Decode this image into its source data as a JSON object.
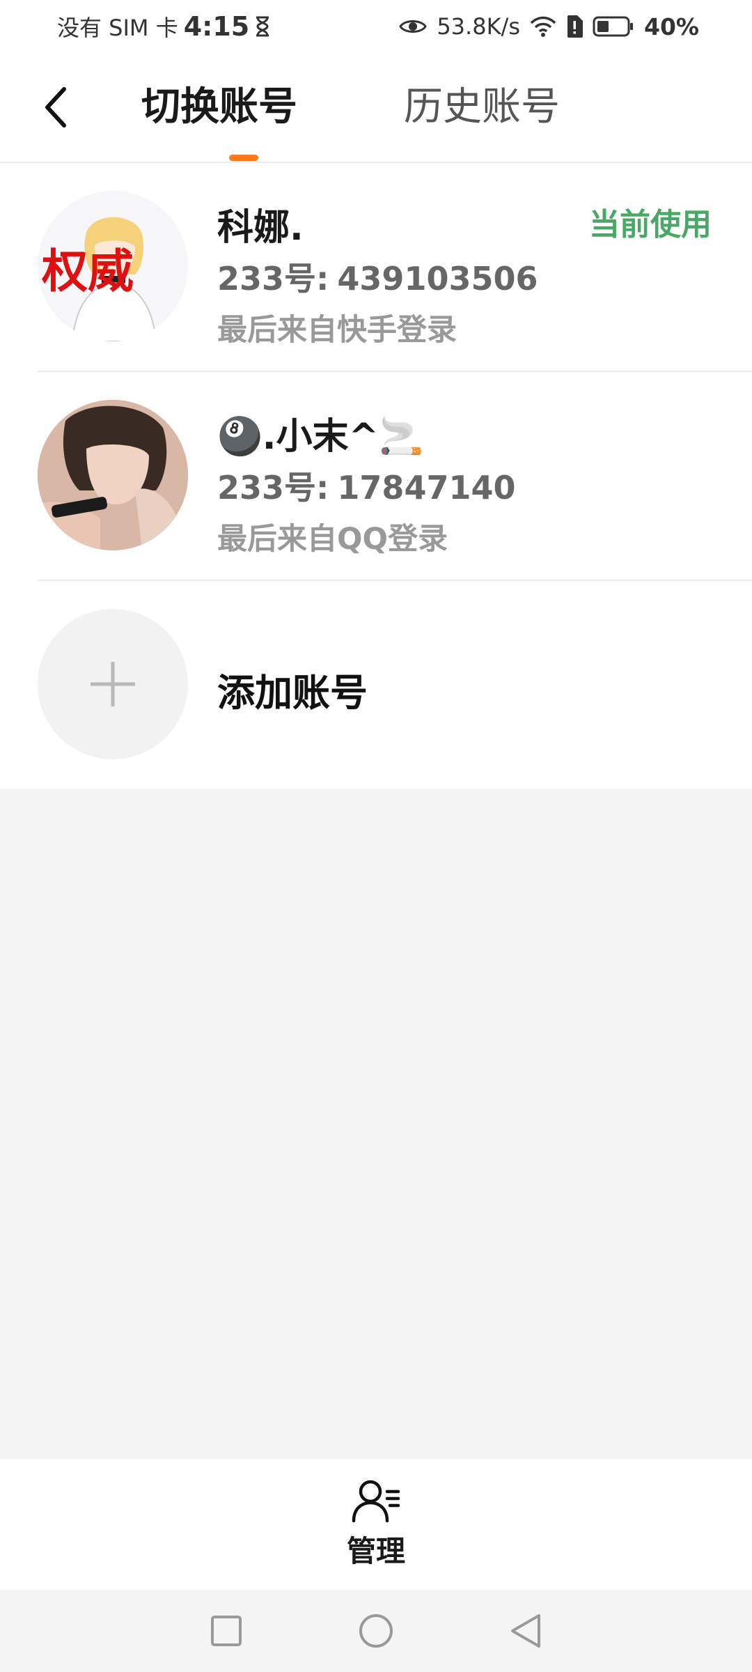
{
  "status_bar": {
    "carrier": "没有 SIM 卡",
    "time": "4:15",
    "net_speed": "53.8K/s",
    "battery_percent": "40%",
    "battery_level": 0.4
  },
  "header": {
    "tabs": [
      {
        "label": "切换账号",
        "active": true
      },
      {
        "label": "历史账号",
        "active": false
      }
    ],
    "accent_color": "#ff7a1a"
  },
  "accounts": [
    {
      "name": "科娜.",
      "uid_label": "233号:",
      "uid": "439103506",
      "login_source": "最后来自快手登录",
      "badge": "当前使用",
      "avatar_text": "权威"
    },
    {
      "name": "🎱.小末^🚬",
      "uid_label": "233号:",
      "uid": "17847140",
      "login_source": "最后来自QQ登录"
    }
  ],
  "add_account": {
    "label": "添加账号"
  },
  "bottom_bar": {
    "manage_label": "管理"
  },
  "colors": {
    "current_badge": "#4aa866",
    "background": "#f4f4f4"
  }
}
